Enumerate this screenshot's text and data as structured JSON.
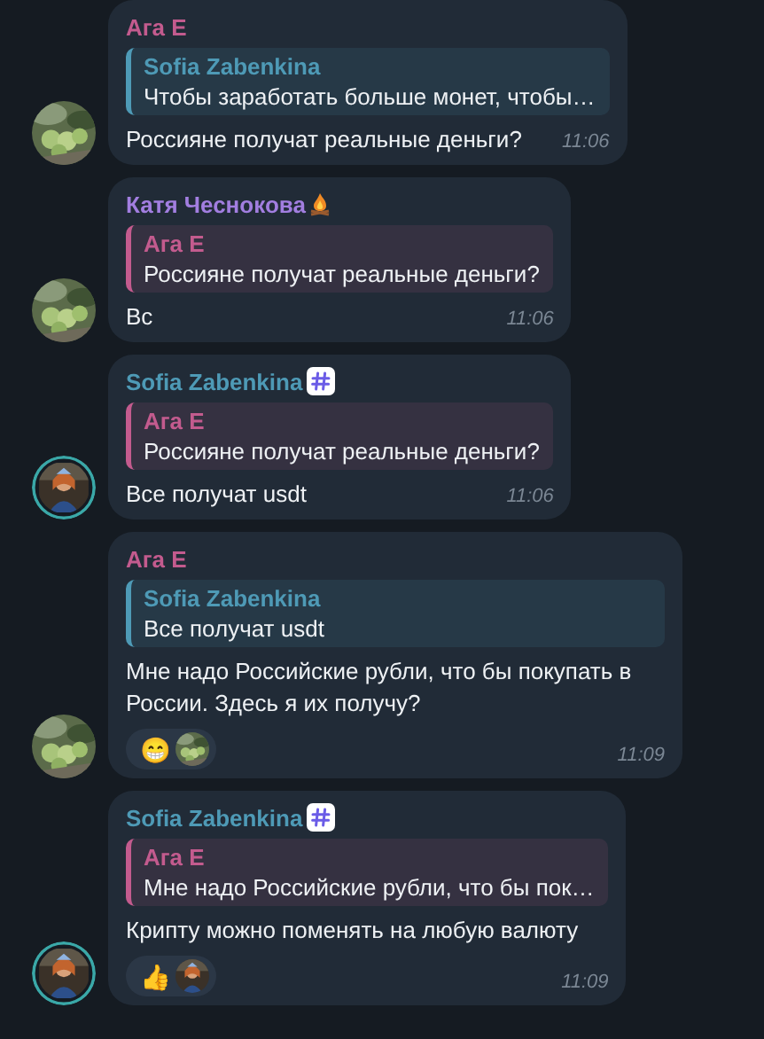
{
  "messages": [
    {
      "sender": "Ага Е",
      "color": "#c35b8e",
      "avatar": {
        "kind": "picture",
        "ring": false
      },
      "reply": {
        "sender": "Sofia Zabenkina",
        "color": "#4e9ab6",
        "text": "Чтобы заработать больше монет, чтобы…"
      },
      "text": "Россияне получат реальные деньги?",
      "time": "11:06"
    },
    {
      "sender": "Катя Чеснокова",
      "color": "#a27ee0",
      "badge": {
        "kind": "fire"
      },
      "avatar": {
        "kind": "picture",
        "ring": false
      },
      "reply": {
        "sender": "Ага Е",
        "color": "#c35b8e",
        "text": "Россияне получат реальные деньги?"
      },
      "text": "Вс",
      "time": "11:06"
    },
    {
      "sender": "Sofia Zabenkina",
      "color": "#4e9ab6",
      "badge": {
        "kind": "hash"
      },
      "avatar": {
        "kind": "picture",
        "ring": true
      },
      "reply": {
        "sender": "Ага Е",
        "color": "#c35b8e",
        "text": "Россияне получат реальные деньги?"
      },
      "text": "Все получат usdt",
      "time": "11:06"
    },
    {
      "sender": "Ага Е",
      "color": "#c35b8e",
      "avatar": {
        "kind": "picture",
        "ring": false
      },
      "reply": {
        "sender": "Sofia Zabenkina",
        "color": "#4e9ab6",
        "text": "Все получат usdt"
      },
      "text": "Мне надо Российские рубли, что бы покупать в России. Здесь я их получу?",
      "reactions": [
        {
          "emoji": "😁"
        }
      ],
      "time": "11:09"
    },
    {
      "sender": "Sofia Zabenkina",
      "color": "#4e9ab6",
      "badge": {
        "kind": "hash"
      },
      "avatar": {
        "kind": "picture",
        "ring": true
      },
      "reply": {
        "sender": "Ага Е",
        "color": "#c35b8e",
        "text": "Мне надо Российские рубли, что бы пок…"
      },
      "text": "Крипту можно поменять на любую валюту",
      "reactions": [
        {
          "emoji": "👍"
        }
      ],
      "time": "11:09"
    }
  ]
}
